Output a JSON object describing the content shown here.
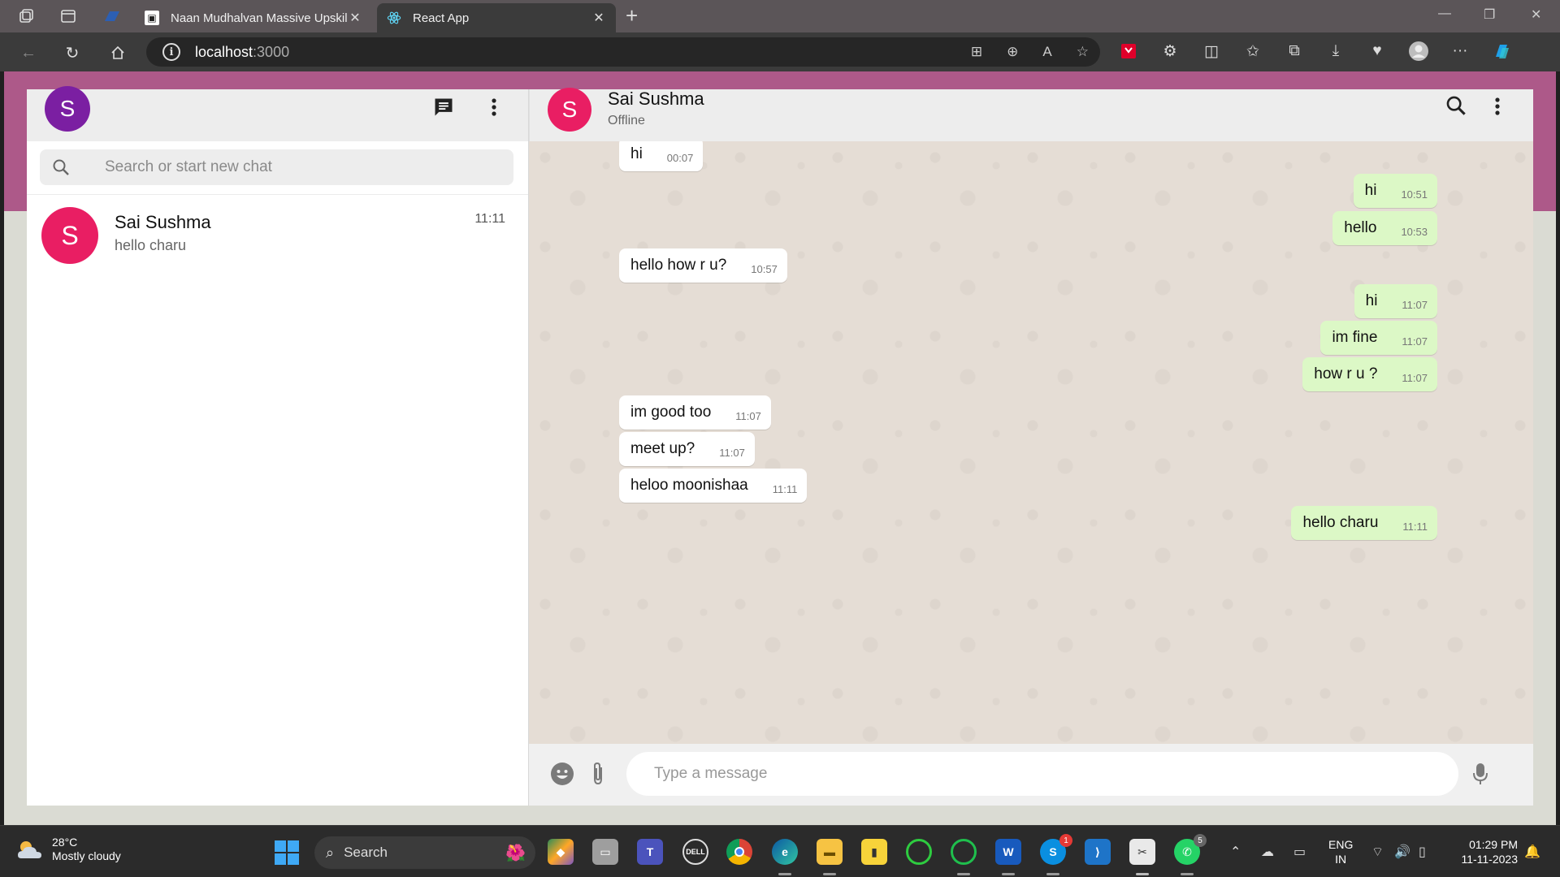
{
  "browser": {
    "tabs": [
      {
        "title": "Naan Mudhalvan Massive Upskil",
        "active": false
      },
      {
        "title": "React App",
        "active": true
      }
    ],
    "address": {
      "host": "localhost",
      "port": ":3000"
    }
  },
  "sidebar": {
    "user_initial": "S",
    "search_placeholder": "Search or start new chat",
    "chats": [
      {
        "initial": "S",
        "name": "Sai Sushma",
        "last_message": "hello charu",
        "time": "11:11"
      }
    ]
  },
  "conversation": {
    "contact": {
      "initial": "S",
      "name": "Sai Sushma",
      "status": "Offline"
    },
    "messages": [
      {
        "direction": "in",
        "text": "hi",
        "time": "00:07"
      },
      {
        "direction": "out",
        "text": "hi",
        "time": "10:51"
      },
      {
        "direction": "out",
        "text": "hello",
        "time": "10:53"
      },
      {
        "direction": "in",
        "text": "hello how r u?",
        "time": "10:57"
      },
      {
        "direction": "out",
        "text": "hi",
        "time": "11:07"
      },
      {
        "direction": "out",
        "text": "im fine",
        "time": "11:07"
      },
      {
        "direction": "out",
        "text": "how r u ?",
        "time": "11:07"
      },
      {
        "direction": "in",
        "text": "im good too",
        "time": "11:07"
      },
      {
        "direction": "in",
        "text": "meet up?",
        "time": "11:07"
      },
      {
        "direction": "in",
        "text": "heloo moonishaa",
        "time": "11:11"
      },
      {
        "direction": "out",
        "text": "hello charu",
        "time": "11:11"
      }
    ],
    "composer_placeholder": "Type a message"
  },
  "taskbar": {
    "weather": {
      "temp": "28°C",
      "condition": "Mostly cloudy"
    },
    "search_label": "Search",
    "skype_badge": "1",
    "whatsapp_badge": "5",
    "language": {
      "line1": "ENG",
      "line2": "IN"
    },
    "clock": {
      "time": "01:29 PM",
      "date": "11-11-2023"
    }
  },
  "colors": {
    "accent_band": "#ad5989",
    "outgoing_bubble": "#dcf8c6",
    "incoming_bubble": "#ffffff",
    "user_avatar": "#7b1fa2",
    "contact_avatar": "#e91e63",
    "chat_background": "#e5ddd5"
  }
}
